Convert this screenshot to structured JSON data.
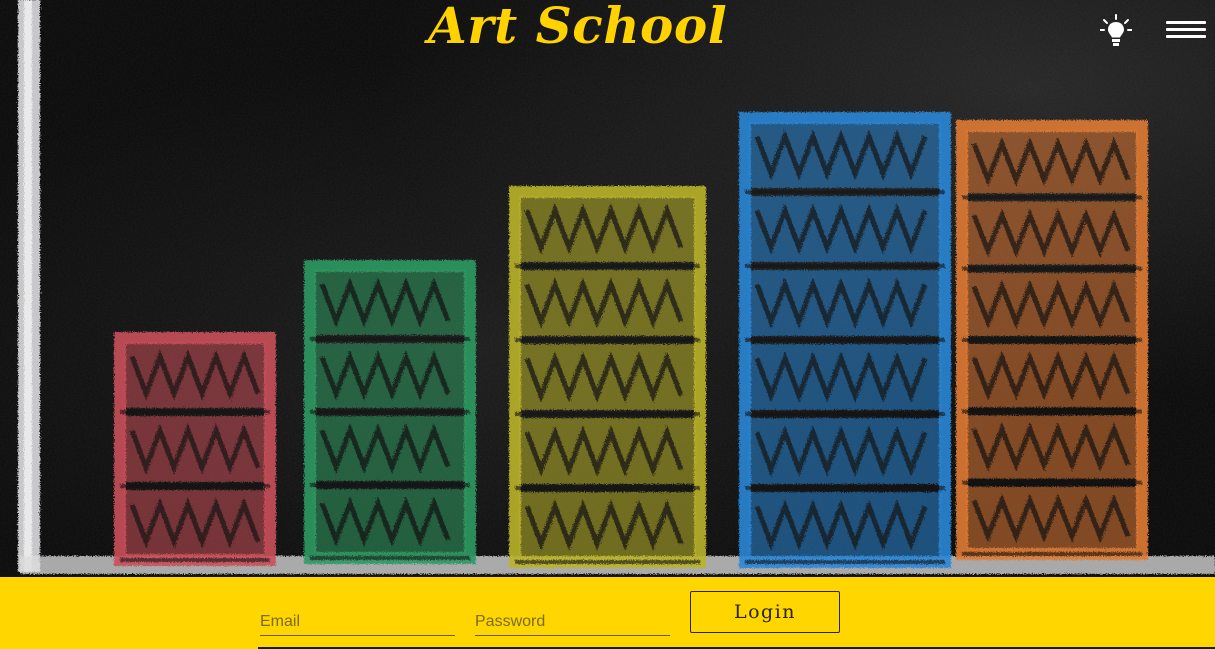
{
  "brand": {
    "title": "Art School"
  },
  "header": {
    "bulb_icon": "lightbulb-icon",
    "menu_icon": "hamburger-menu-icon"
  },
  "hero": {
    "image": "chalkboard-bar-chart-drawing",
    "bar_colors": [
      "#c9505a",
      "#2f9a62",
      "#b9b32a",
      "#2a86d6",
      "#df7a33"
    ]
  },
  "login": {
    "email_placeholder": "Email",
    "password_placeholder": "Password",
    "login_label": "Login"
  },
  "colors": {
    "accent": "#ffd600",
    "title": "#ffd200",
    "background": "#0a0a0a"
  }
}
